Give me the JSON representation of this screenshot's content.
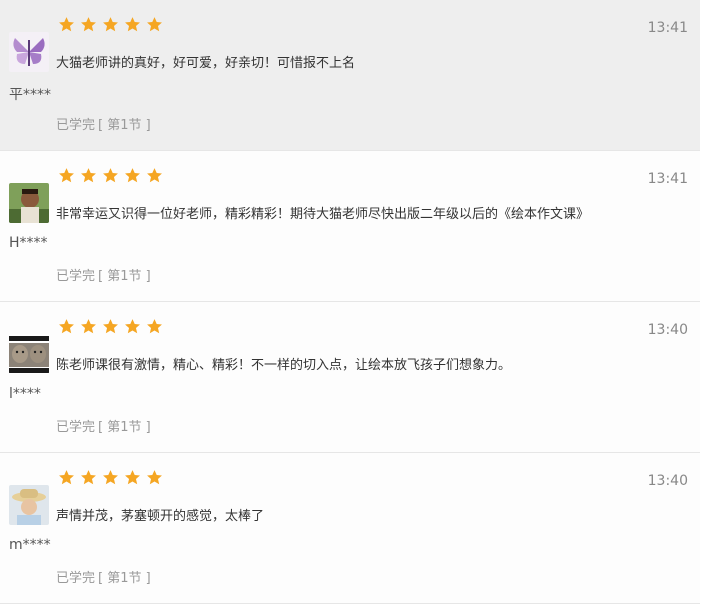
{
  "reviews": [
    {
      "user": "平****",
      "rating": 5,
      "time": "13:41",
      "comment": "大猫老师讲的真好，好可爱，好亲切！可惜报不上名",
      "status": "已学完",
      "section": "[ 第1节 ]",
      "avatar": "butterfly-avatar",
      "highlighted": true
    },
    {
      "user": "H****",
      "rating": 5,
      "time": "13:41",
      "comment": "非常幸运又识得一位好老师，精彩精彩！期待大猫老师尽快出版二年级以后的《绘本作文课》",
      "status": "已学完",
      "section": "[ 第1节 ]",
      "avatar": "child-photo-avatar",
      "highlighted": false
    },
    {
      "user": "l****",
      "rating": 5,
      "time": "13:40",
      "comment": "陈老师课很有激情，精心、精彩！不一样的切入点，让绘本放飞孩子们想象力。",
      "status": "已学完",
      "section": "[ 第1节 ]",
      "avatar": "cats-photo-avatar",
      "highlighted": false
    },
    {
      "user": "m****",
      "rating": 5,
      "time": "13:40",
      "comment": "声情并茂，茅塞顿开的感觉，太棒了",
      "status": "已学完",
      "section": "[ 第1节 ]",
      "avatar": "hat-photo-avatar",
      "highlighted": false
    }
  ],
  "colors": {
    "star": "#f5a623",
    "highlight_bg": "#eeeeee"
  }
}
